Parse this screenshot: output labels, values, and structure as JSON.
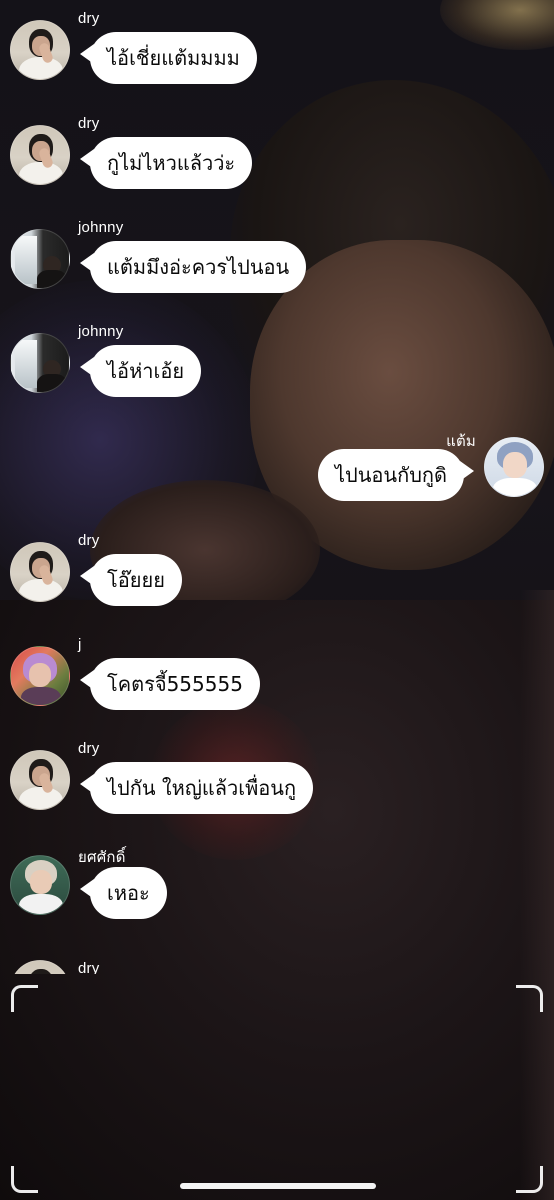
{
  "comments": [
    {
      "user": "dry",
      "text": "ไอ้เชี่ยแต้มมมม",
      "avatar": "avatar-dry"
    },
    {
      "user": "dry",
      "text": "กูไม่ไหวแล้วว่ะ",
      "avatar": "avatar-dry"
    },
    {
      "user": "johnny",
      "text": "แต้มมึงอ่ะควรไปนอน",
      "avatar": "avatar-johnny"
    },
    {
      "user": "johnny",
      "text": "ไอ้ห่าเอ้ย",
      "avatar": "avatar-johnny"
    },
    {
      "user": "แต้ม",
      "text": "ไปนอนกับกูดิ",
      "avatar": "avatar-taem"
    },
    {
      "user": "dry",
      "text": "โอ๊ยยย",
      "avatar": "avatar-dry"
    },
    {
      "user": "j",
      "text": "โคตรจี้555555",
      "avatar": "avatar-j"
    },
    {
      "user": "dry",
      "text": "ไปกัน ใหญ่แล้วเพื่อนกู",
      "avatar": "avatar-dry"
    },
    {
      "user": "ยศศักดิ์",
      "text": "เหอะ",
      "avatar": "avatar-yot"
    }
  ],
  "partial_comment": {
    "user": "dry",
    "avatar": "avatar-dry"
  },
  "colors": {
    "bubble": "#ffffff",
    "bubble_text": "#0b0b0b",
    "username": "#ffffff"
  }
}
